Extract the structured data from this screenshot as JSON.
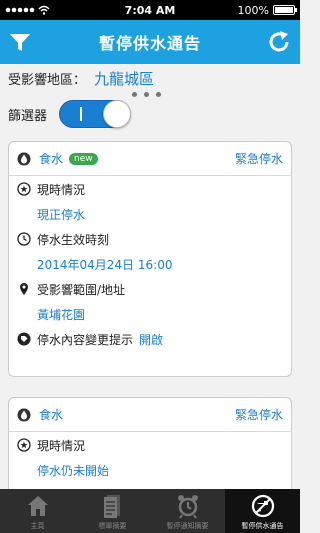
{
  "status_bar": {
    "time": "7:04 AM",
    "battery": "100%"
  },
  "header": {
    "title": "暫停供水通告"
  },
  "region": {
    "label": "受影響地區：",
    "value": "九龍城區"
  },
  "filter": {
    "label": "篩選器",
    "toggle_on": true
  },
  "cards": [
    {
      "type": "食水",
      "badge": "new",
      "kind": "緊急停水",
      "status_label": "現時情況",
      "status_value": "現正停水",
      "time_label": "停水生效時刻",
      "time_value": "2014年04月24日 16:00",
      "area_label": "受影響範圍/地址",
      "area_value": "黃埔花園",
      "notify_label": "停水內容變更提示",
      "notify_action": "開啟"
    },
    {
      "type": "食水",
      "kind": "緊急停水",
      "status_label": "現時情況",
      "status_value": "停水仍未開始"
    }
  ],
  "tabs": [
    {
      "label": "主頁",
      "icon": "home-icon"
    },
    {
      "label": "標單摘要",
      "icon": "document-icon"
    },
    {
      "label": "暫停通知摘要",
      "icon": "alarm-clock-icon"
    },
    {
      "label": "暫停供水通告",
      "icon": "no-water-icon",
      "active": true
    }
  ],
  "colors": {
    "accent": "#1da1e0",
    "link": "#1a7fd1",
    "badge": "#3aa84a"
  }
}
